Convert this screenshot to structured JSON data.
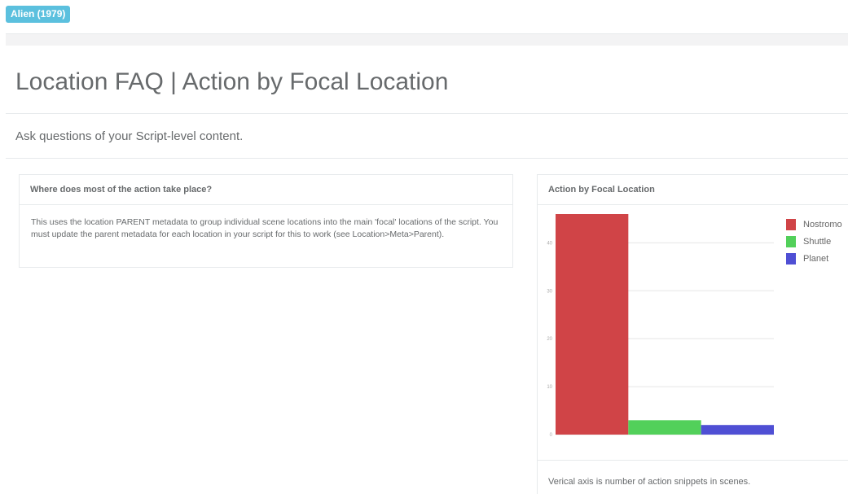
{
  "project": {
    "badge": "Alien (1979)"
  },
  "page": {
    "title": "Location FAQ | Action by Focal Location",
    "subtitle": "Ask questions of your Script-level content."
  },
  "question_panel": {
    "title": "Where does most of the action take place?",
    "body": "This uses the location PARENT metadata to group individual scene locations into the main 'focal' locations of the script. You must update the parent metadata for each location in your script for this to work (see Location>Meta>Parent)."
  },
  "chart_panel": {
    "title": "Action by Focal Location",
    "note": "Verical axis is number of action snippets in scenes."
  },
  "chart_data": {
    "type": "bar",
    "title": "Action by Focal Location",
    "categories": [
      "Nostromo",
      "Shuttle",
      "Planet"
    ],
    "values": [
      46,
      3,
      2
    ],
    "colors": [
      "#d04447",
      "#52d05a",
      "#4f4fd4"
    ],
    "yticks": [
      0,
      10,
      20,
      30,
      40
    ],
    "ylim": [
      0,
      46
    ],
    "grid": true,
    "legend_position": "right",
    "legend": [
      {
        "label": "Nostromo",
        "color": "#d04447"
      },
      {
        "label": "Shuttle",
        "color": "#52d05a"
      },
      {
        "label": "Planet",
        "color": "#4f4fd4"
      }
    ],
    "xlabel": "",
    "ylabel": ""
  }
}
